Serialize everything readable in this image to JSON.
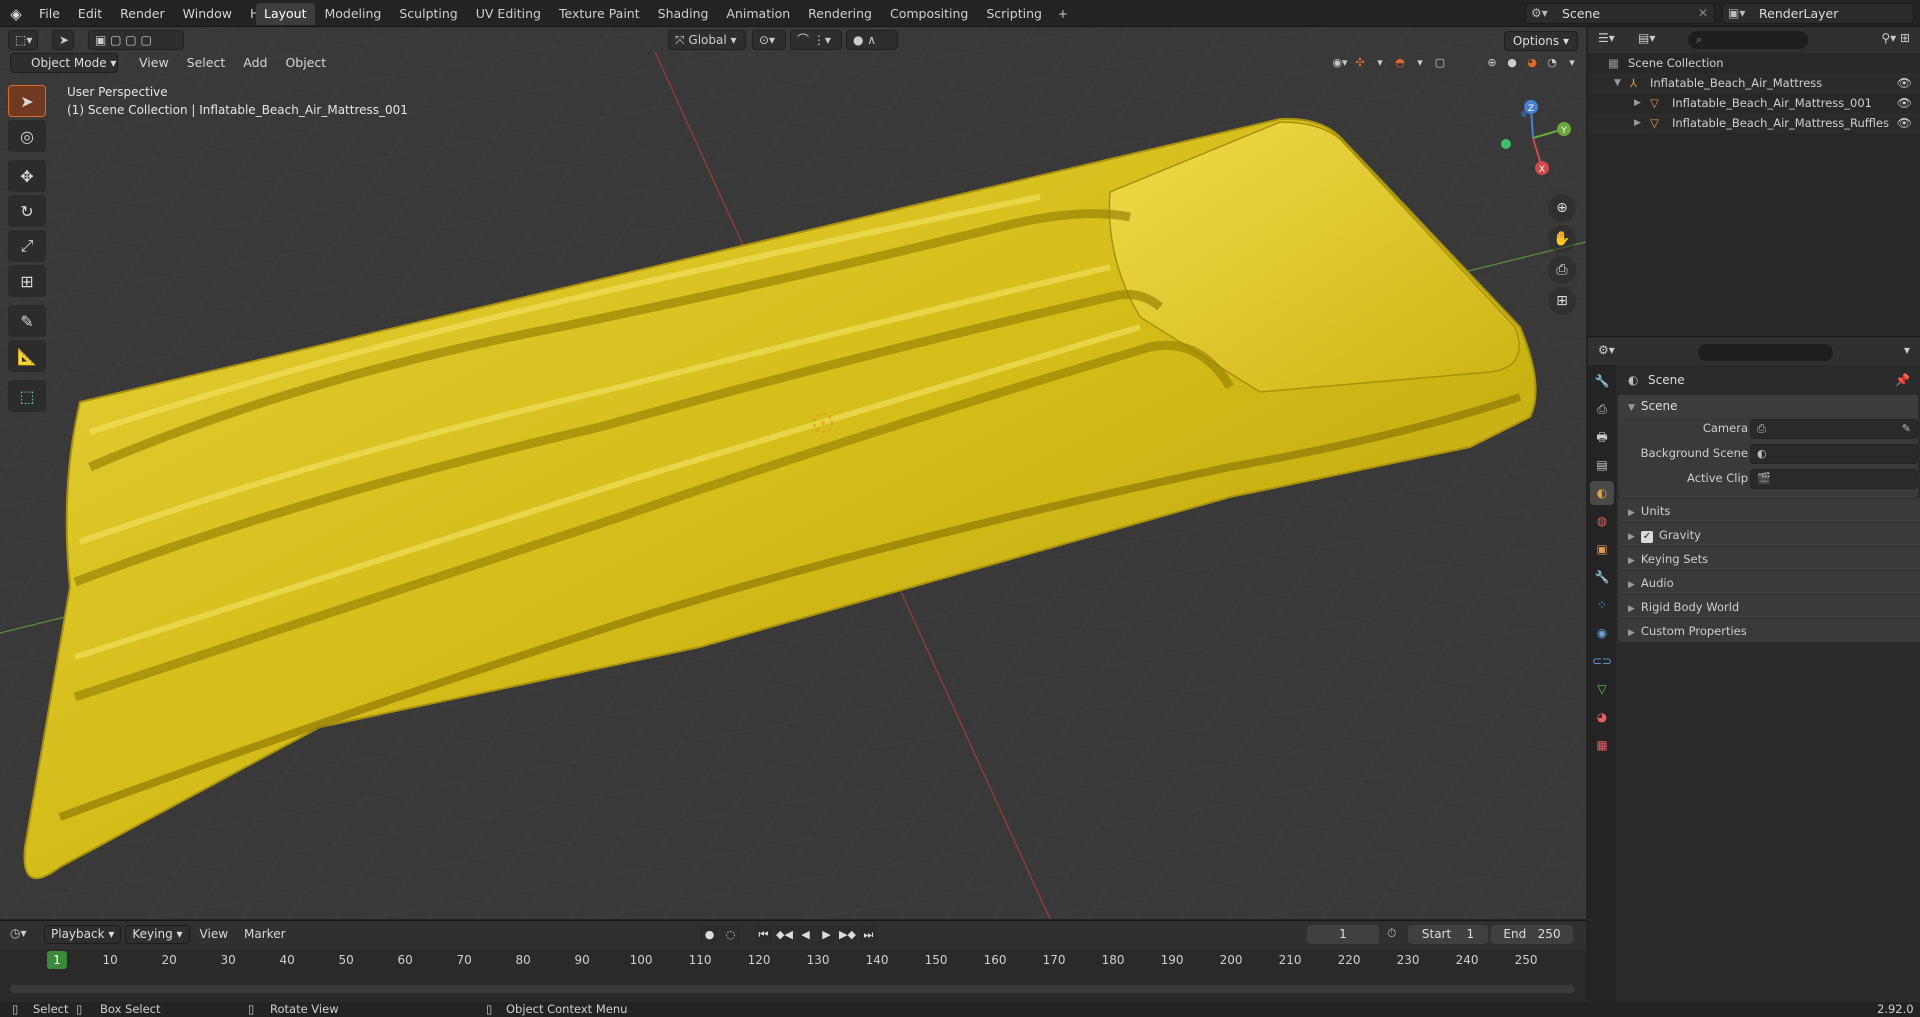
{
  "menu": [
    "File",
    "Edit",
    "Render",
    "Window",
    "Help"
  ],
  "workspaces": [
    "Layout",
    "Modeling",
    "Sculpting",
    "UV Editing",
    "Texture Paint",
    "Shading",
    "Animation",
    "Rendering",
    "Compositing",
    "Scripting"
  ],
  "active_workspace": "Layout",
  "scene_name": "Scene",
  "render_layer": "RenderLayer",
  "viewport": {
    "mode": "Object Mode",
    "menu": [
      "View",
      "Select",
      "Add",
      "Object"
    ],
    "transform_orientation": "Global",
    "options_label": "Options",
    "perspective_label": "User Perspective",
    "collection_label": "(1) Scene Collection | Inflatable_Beach_Air_Mattress_001",
    "axis_x": "X",
    "axis_y": "Y",
    "axis_z": "Z"
  },
  "outliner": {
    "root": "Scene Collection",
    "items": [
      {
        "name": "Inflatable_Beach_Air_Mattress"
      },
      {
        "name": "Inflatable_Beach_Air_Mattress_001"
      },
      {
        "name": "Inflatable_Beach_Air_Mattress_Ruffles"
      }
    ]
  },
  "properties": {
    "context_title": "Scene",
    "section_title": "Scene",
    "fields": [
      {
        "label": "Camera"
      },
      {
        "label": "Background Scene"
      },
      {
        "label": "Active Clip"
      }
    ],
    "collapsed_sections": [
      "Units",
      "Gravity",
      "Keying Sets",
      "Audio",
      "Rigid Body World",
      "Custom Properties"
    ],
    "gravity_checked": true
  },
  "timeline": {
    "menu_dropdowns": [
      "Playback",
      "Keying"
    ],
    "menu_plain": [
      "View",
      "Marker"
    ],
    "current_frame": "1",
    "start_label": "Start",
    "start_value": "1",
    "end_label": "End",
    "end_value": "250",
    "ticks": [
      "10",
      "20",
      "30",
      "40",
      "50",
      "60",
      "70",
      "80",
      "90",
      "100",
      "110",
      "120",
      "130",
      "140",
      "150",
      "160",
      "170",
      "180",
      "190",
      "200",
      "210",
      "220",
      "230",
      "240",
      "250"
    ]
  },
  "statusbar": {
    "select": "Select",
    "box_select": "Box Select",
    "rotate_view": "Rotate View",
    "context_menu": "Object Context Menu",
    "version": "2.92.0"
  },
  "colors": {
    "accent": "#4772b3",
    "active_tool": "#e06a2e",
    "mattress": "#d9c21d"
  }
}
